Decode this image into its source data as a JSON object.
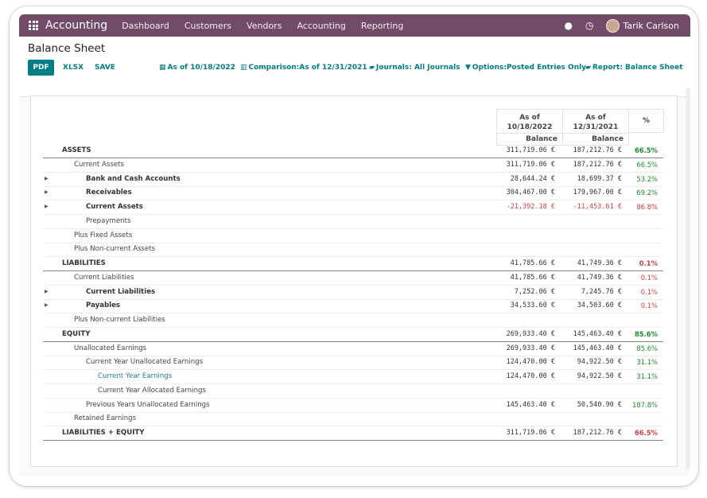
{
  "navbar": {
    "brand": "Accounting",
    "menu": [
      "Dashboard",
      "Customers",
      "Vendors",
      "Accounting",
      "Reporting"
    ],
    "user": "Tarik Carlson",
    "icons": [
      "apps-grid-icon",
      "chat-icon",
      "clock-icon"
    ]
  },
  "page": {
    "title": "Balance Sheet"
  },
  "toolbar": {
    "pdf": "PDF",
    "xlsx": "XLSX",
    "save": "SAVE",
    "filters": [
      {
        "icon": "calendar-icon",
        "glyph": "▦",
        "label": "As of 10/18/2022"
      },
      {
        "icon": "bar-chart-icon",
        "glyph": "▥",
        "label": "Comparison:As of 12/31/2021"
      },
      {
        "icon": "book-icon",
        "glyph": "▰",
        "label": "Journals: All Journals"
      },
      {
        "icon": "filter-icon",
        "glyph": "▼",
        "label": "Options:Posted Entries Only"
      },
      {
        "icon": "book-icon",
        "glyph": "▰",
        "label": "Report: Balance Sheet"
      }
    ]
  },
  "columns": [
    {
      "line1": "As of",
      "line2": "10/18/2022",
      "sub": "Balance"
    },
    {
      "line1": "As of",
      "line2": "12/31/2021",
      "sub": "Balance"
    },
    {
      "label": "%"
    }
  ],
  "colors": {
    "positive": "#1e8a2e",
    "negative": "#d03d3d",
    "accent": "#017e84",
    "navbar": "#714b67"
  },
  "rows": [
    {
      "label": "ASSETS",
      "level": 0,
      "bold": true,
      "section": true,
      "v1": "311,719.06 €",
      "v2": "187,212.76 €",
      "pct": "66.5%",
      "pct_sign": "pos",
      "pct_bold": true
    },
    {
      "label": "Current Assets",
      "level": 1,
      "v1": "311,719.06 €",
      "v2": "187,212.76 €",
      "pct": "66.5%",
      "pct_sign": "pos"
    },
    {
      "label": "Bank and Cash Accounts",
      "level": 2,
      "bold": true,
      "caret": true,
      "v1": "28,644.24 €",
      "v2": "18,699.37 €",
      "pct": "53.2%",
      "pct_sign": "pos"
    },
    {
      "label": "Receivables",
      "level": 2,
      "bold": true,
      "caret": true,
      "v1": "304,467.00 €",
      "v2": "179,967.00 €",
      "pct": "69.2%",
      "pct_sign": "pos"
    },
    {
      "label": "Current Assets",
      "level": 2,
      "bold": true,
      "caret": true,
      "v1": "-21,392.18 €",
      "v2": "-11,453.61 €",
      "neg": true,
      "pct": "86.8%",
      "pct_sign": "neg"
    },
    {
      "label": "Prepayments",
      "level": 2
    },
    {
      "label": "Plus Fixed Assets",
      "level": 1
    },
    {
      "label": "Plus Non-current Assets",
      "level": 1
    },
    {
      "label": "LIABILITIES",
      "level": 0,
      "bold": true,
      "section": true,
      "v1": "41,785.66 €",
      "v2": "41,749.36 €",
      "pct": "0.1%",
      "pct_sign": "neg",
      "pct_bold": true
    },
    {
      "label": "Current Liabilities",
      "level": 1,
      "v1": "41,785.66 €",
      "v2": "41,749.36 €",
      "pct": "0.1%",
      "pct_sign": "neg"
    },
    {
      "label": "Current Liabilities",
      "level": 2,
      "bold": true,
      "caret": true,
      "v1": "7,252.06 €",
      "v2": "7,245.76 €",
      "pct": "0.1%",
      "pct_sign": "neg"
    },
    {
      "label": "Payables",
      "level": 2,
      "bold": true,
      "caret": true,
      "v1": "34,533.60 €",
      "v2": "34,503.60 €",
      "pct": "0.1%",
      "pct_sign": "neg"
    },
    {
      "label": "Plus Non-current Liabilities",
      "level": 1
    },
    {
      "label": "EQUITY",
      "level": 0,
      "bold": true,
      "section": true,
      "v1": "269,933.40 €",
      "v2": "145,463.40 €",
      "pct": "85.6%",
      "pct_sign": "pos",
      "pct_bold": true
    },
    {
      "label": "Unallocated Earnings",
      "level": 1,
      "v1": "269,933.40 €",
      "v2": "145,463.40 €",
      "pct": "85.6%",
      "pct_sign": "pos"
    },
    {
      "label": "Current Year Unallocated Earnings",
      "level": 2,
      "v1": "124,470.00 €",
      "v2": "94,922.50 €",
      "pct": "31.1%",
      "pct_sign": "pos"
    },
    {
      "label": "Current Year Earnings",
      "level": 3,
      "link": true,
      "v1": "124,470.00 €",
      "v2": "94,922.50 €",
      "pct": "31.1%",
      "pct_sign": "pos"
    },
    {
      "label": "Current Year Allocated Earnings",
      "level": 3
    },
    {
      "label": "Previous Years Unallocated Earnings",
      "level": 2,
      "v1": "145,463.40 €",
      "v2": "50,540.90 €",
      "pct": "187.8%",
      "pct_sign": "pos"
    },
    {
      "label": "Retained Earnings",
      "level": 1
    },
    {
      "label": "LIABILITIES + EQUITY",
      "level": 0,
      "bold": true,
      "section": true,
      "v1": "311,719.06 €",
      "v2": "187,212.76 €",
      "pct": "66.5%",
      "pct_sign": "neg",
      "pct_bold": true
    }
  ]
}
